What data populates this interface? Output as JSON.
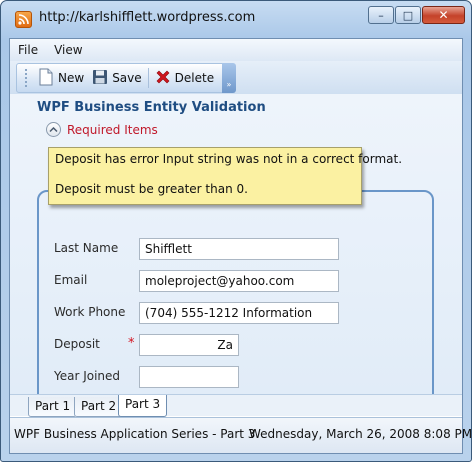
{
  "window": {
    "title": "http://karlshifflett.wordpress.com",
    "min_label": "–",
    "max_label": "□",
    "close_label": "✕"
  },
  "menu": {
    "items": [
      "File",
      "View"
    ]
  },
  "toolbar": {
    "new_label": "New",
    "save_label": "Save",
    "delete_label": "Delete",
    "overflow_label": "»"
  },
  "page": {
    "title": "WPF Business Entity Validation",
    "required_items_label": "Required Items"
  },
  "tooltip": {
    "line1": "Deposit has error Input string was not in a correct format.",
    "line2": "Deposit must be greater than 0."
  },
  "form": {
    "last_name": {
      "label": "Last Name",
      "value": "Shifflett"
    },
    "email": {
      "label": "Email",
      "value": "moleproject@yahoo.com"
    },
    "work_phone": {
      "label": "Work Phone",
      "value": "(704) 555-1212  Information"
    },
    "deposit": {
      "label": "Deposit",
      "value": "Za",
      "required_marker": "*"
    },
    "year_joined": {
      "label": "Year Joined",
      "value": ""
    }
  },
  "tabs": [
    "Part 1",
    "Part 2",
    "Part 3"
  ],
  "status": {
    "left": "WPF Business Application Series - Part 3",
    "right": "Wednesday, March 26, 2008 8:08 PM"
  },
  "colors": {
    "accent": "#1f4d82",
    "required": "#c0182a",
    "tooltip_bg": "#fbf1a2"
  }
}
